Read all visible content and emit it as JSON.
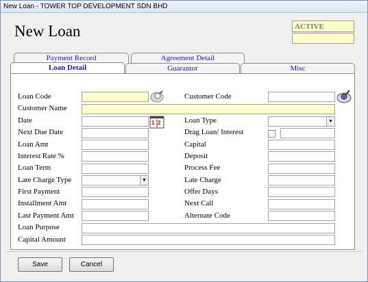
{
  "window": {
    "title": "New Loan - TOWER TOP DEVELOPMENT SDN BHD"
  },
  "header": {
    "title": "New Loan",
    "status": "ACTIVE"
  },
  "tabs": {
    "payment_record": "Payment Record",
    "agreement_detail": "Agreement Detail",
    "loan_detail": "Loan Detail",
    "guarantor": "Guarantor",
    "misc": "Misc"
  },
  "form": {
    "loan_code": "Loan Code",
    "customer_code": "Customer Code",
    "customer_name": "Customer Name",
    "date": "Date",
    "loan_type": "Loan Type",
    "next_due_date": "Next Due Date",
    "drag_loan_interest": "Drag Loan/ Interest",
    "loan_amt": "Loan Amt",
    "capital": "Capital",
    "interest_rate": "Interest Rate %",
    "deposit": "Deposit",
    "loan_term": "Loan Term",
    "process_fee": "Process Fee",
    "late_charge_type": "Late Charge Type",
    "late_charge": "Late Charge",
    "first_payment": "First Payment",
    "offer_days": "Offer Days",
    "installment_amt": "Installment Amt",
    "next_call": "Next Call",
    "last_payment_amt": "Last Payment Amt",
    "alternate_code": "Alternate Code",
    "loan_purpose": "Loan Purpose",
    "capital_amount": "Capital Amount"
  },
  "buttons": {
    "save": "Save",
    "cancel": "Cancel"
  },
  "icons": {
    "search": "magnifier-icon",
    "calendar": "calendar-icon",
    "lookup": "lookup-icon",
    "dropdown": "chevron-down-icon"
  },
  "colors": {
    "required_field": "#ffffcc",
    "tab_text": "#1a1a8c"
  }
}
